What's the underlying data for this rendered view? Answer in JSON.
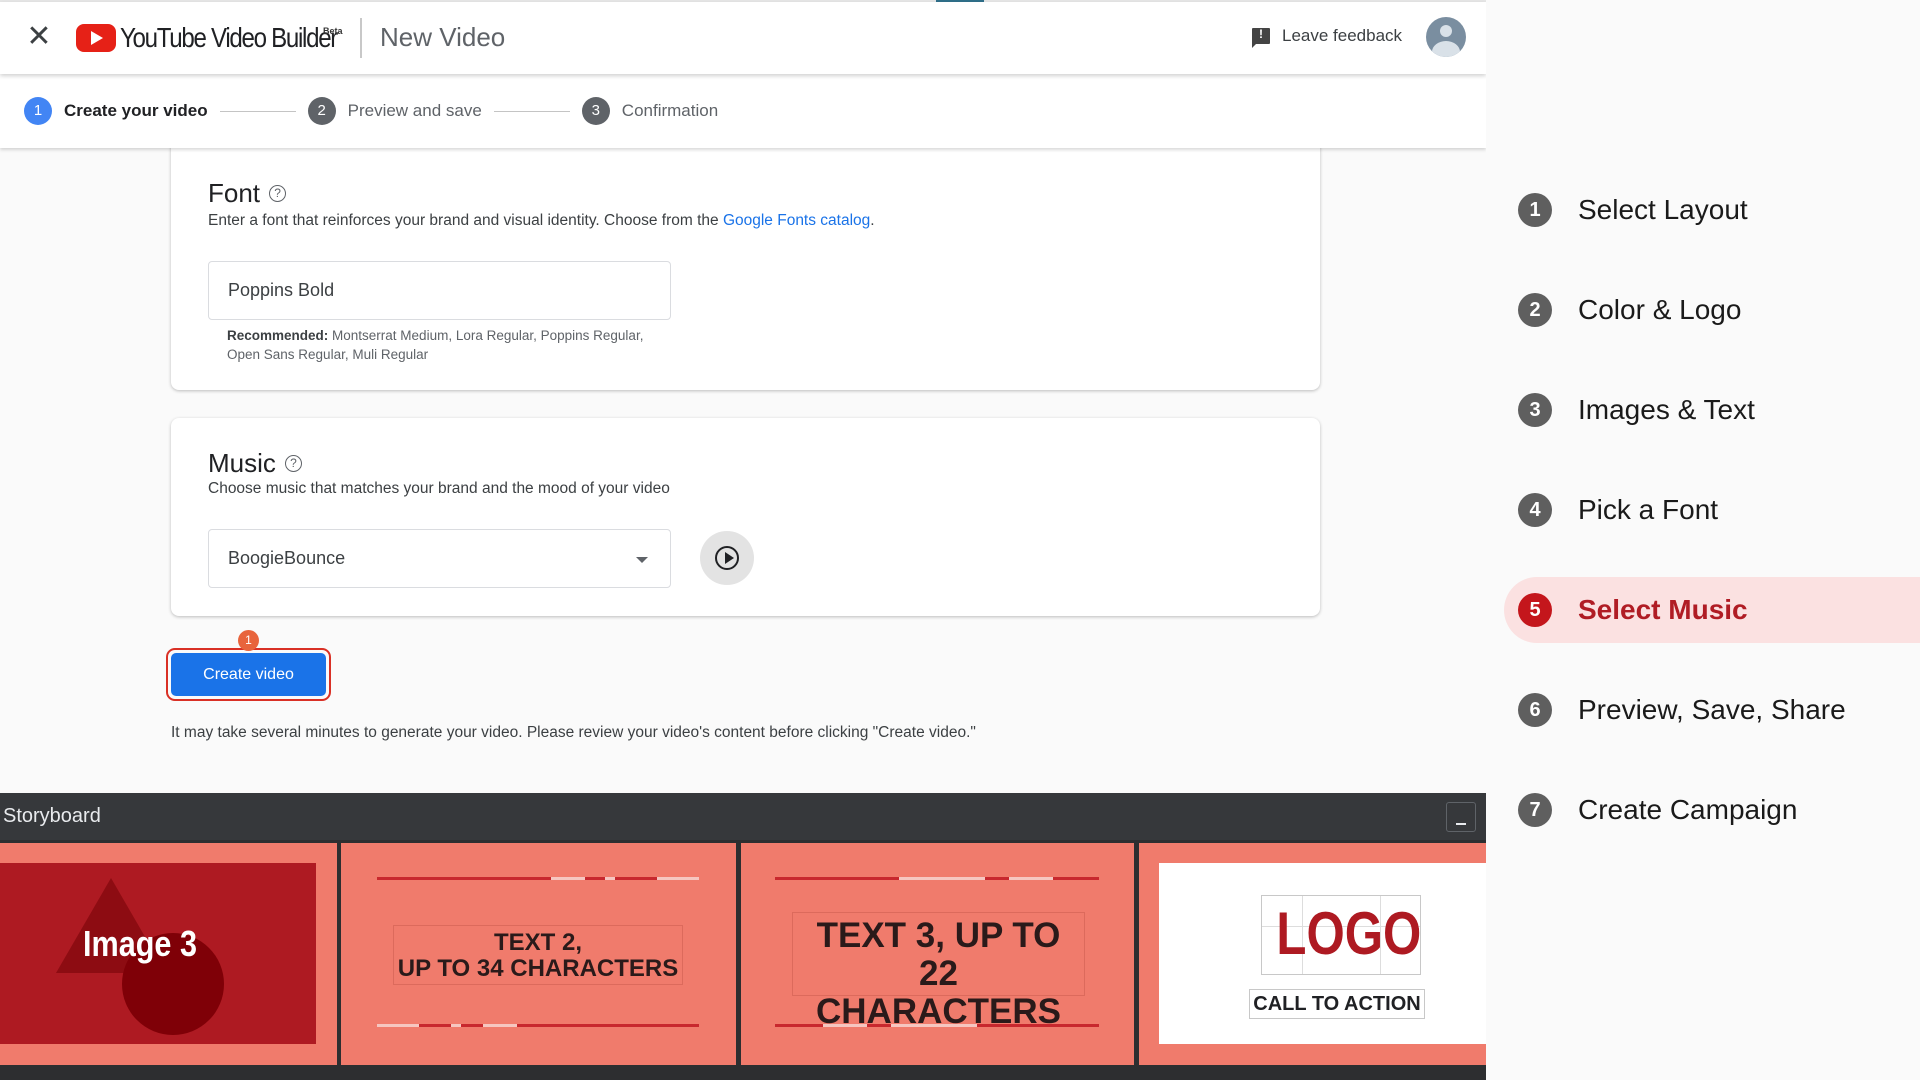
{
  "header": {
    "close_icon": "close-icon",
    "brand": "YouTube Video Builder",
    "beta": "Beta",
    "title": "New Video",
    "feedback_label": "Leave feedback",
    "feedback_icon": "feedback-icon",
    "avatar_icon": "account-avatar"
  },
  "stepper": [
    {
      "num": "1",
      "label": "Create your video",
      "active": true
    },
    {
      "num": "2",
      "label": "Preview and save",
      "active": false
    },
    {
      "num": "3",
      "label": "Confirmation",
      "active": false
    }
  ],
  "font_section": {
    "title": "Font",
    "description": "Enter a font that reinforces your brand and visual identity. Choose from the ",
    "link": "Google Fonts catalog",
    "link_suffix": ".",
    "input_value": "Poppins Bold",
    "recommended_label": "Recommended:",
    "recommended_text": " Montserrat Medium, Lora Regular, Poppins Regular, Open Sans Regular, Muli Regular"
  },
  "music_section": {
    "title": "Music",
    "description": "Choose music that matches your brand and the mood of your video",
    "selected": "BoogieBounce",
    "play_icon": "play-circle-icon"
  },
  "actions": {
    "create_label": "Create video",
    "badge": "1",
    "note": "It may take several minutes to generate your video. Please review your video's content before clicking \"Create video.\""
  },
  "storyboard": {
    "title": "Storyboard",
    "tiles": [
      {
        "type": "image",
        "label": "Image 3"
      },
      {
        "type": "text",
        "line1": "TEXT 2,",
        "line2": "UP TO 34 CHARACTERS"
      },
      {
        "type": "text",
        "line1": "TEXT 3, UP TO",
        "line2": "22 CHARACTERS"
      },
      {
        "type": "logo",
        "logo": "LOGO",
        "cta": "CALL TO ACTION"
      }
    ]
  },
  "guide": {
    "items": [
      {
        "num": "1",
        "label": "Select Layout"
      },
      {
        "num": "2",
        "label": "Color & Logo"
      },
      {
        "num": "3",
        "label": "Images & Text"
      },
      {
        "num": "4",
        "label": "Pick a Font"
      },
      {
        "num": "5",
        "label": "Select Music",
        "active": true
      },
      {
        "num": "6",
        "label": "Preview, Save, Share"
      },
      {
        "num": "7",
        "label": "Create Campaign"
      }
    ]
  },
  "colors": {
    "accent_blue": "#1a73e8",
    "highlight_red": "#c4161c",
    "storyboard_salmon": "#f07b6c"
  }
}
